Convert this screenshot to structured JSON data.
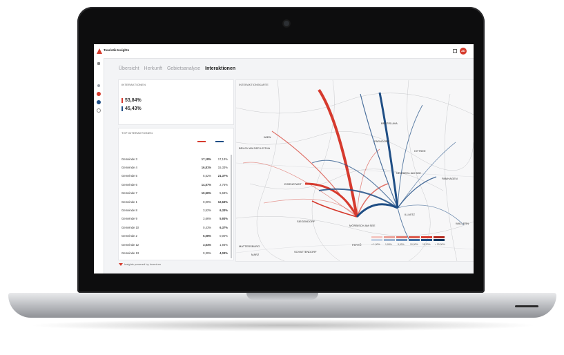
{
  "app": {
    "brand": "Touristik Insights",
    "avatar_initials": "AD",
    "accent_color": "#d53a2c",
    "secondary_color": "#1f4e85"
  },
  "tabs": [
    {
      "label": "Übersicht",
      "active": false
    },
    {
      "label": "Herkunft",
      "active": false
    },
    {
      "label": "Gebietsanalyse",
      "active": false
    },
    {
      "label": "Interaktionen",
      "active": true
    }
  ],
  "interaktionen_panel": {
    "title": "INTERAKTIONEN",
    "values": [
      {
        "label": "53,84%",
        "color": "#d63a2e"
      },
      {
        "label": "45,43%",
        "color": "#1f4e85"
      }
    ]
  },
  "top_panel": {
    "title": "TOP INTERAKTIONEN",
    "rows": [
      {
        "name": "Gemeinde 3",
        "red": "17,18%",
        "blue": "17,13%"
      },
      {
        "name": "Gemeinde 4",
        "red": "16,81%",
        "blue": "15,33%"
      },
      {
        "name": "Gemeinde 5",
        "red": "5,52%",
        "blue": "21,37%"
      },
      {
        "name": "Gemeinde 6",
        "red": "14,57%",
        "blue": "2,75%"
      },
      {
        "name": "Gemeinde 7",
        "red": "10,56%",
        "blue": "5,63%"
      },
      {
        "name": "Gemeinde 1",
        "red": "0,00%",
        "blue": "12,63%"
      },
      {
        "name": "Gemeinde 8",
        "red": "3,52%",
        "blue": "6,33%"
      },
      {
        "name": "Gemeinde 9",
        "red": "3,66%",
        "blue": "5,93%"
      },
      {
        "name": "Gemeinde 10",
        "red": "0,43%",
        "blue": "6,37%"
      },
      {
        "name": "Gemeinde 2",
        "red": "6,08%",
        "blue": "0,00%"
      },
      {
        "name": "Gemeinde 12",
        "red": "3,64%",
        "blue": "1,93%"
      },
      {
        "name": "Gemeinde 13",
        "red": "0,39%",
        "blue": "4,03%"
      }
    ]
  },
  "map_panel": {
    "title": "INTERAKTIONSKARTE",
    "towns": [
      "BRATISLAVA",
      "EISENSTADT",
      "NEUSIEDL AM SEE",
      "ILLMITZ",
      "MÖRBISCH AM SEE",
      "SIEGENDORF",
      "SCHATTENDORF",
      "MATTERSBURG",
      "MARZ",
      "WALLERN",
      "PAMHAGEN",
      "FERTŐ",
      "KITTSEE",
      "PARNDORF",
      "BRUCK AN DER LEITHA",
      "WIEN"
    ],
    "legend": [
      "< 1,00%",
      "1,00%",
      "5,00%",
      "10,00%",
      "15,00%",
      "> 20,00%"
    ]
  },
  "footer": {
    "text": "Insights powered by Invenium"
  }
}
